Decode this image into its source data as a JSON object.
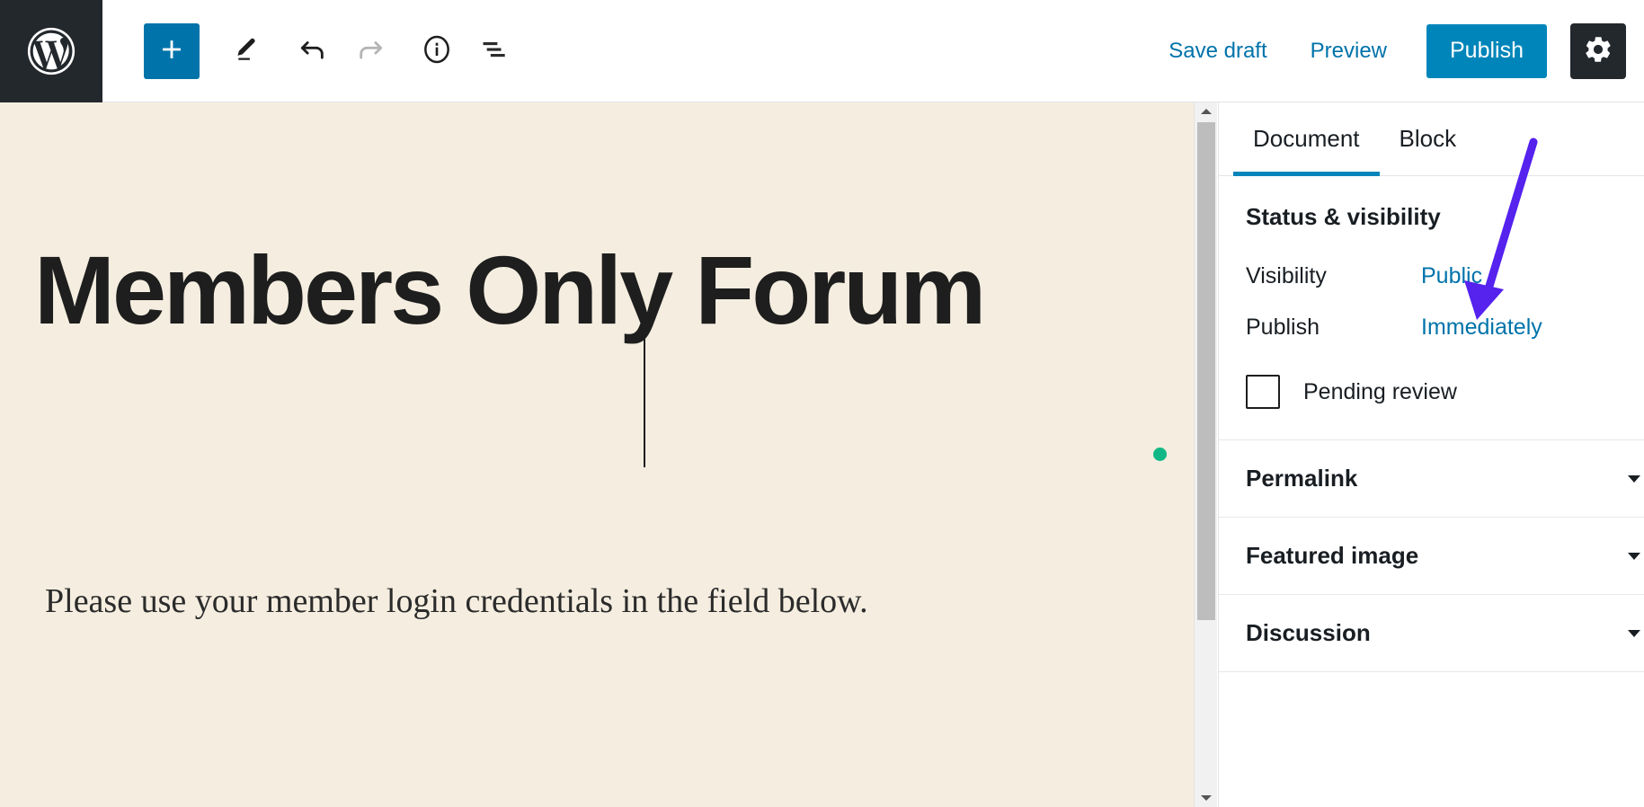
{
  "app": {
    "name": "WordPress Block Editor",
    "logo_icon": "wordpress-logo-icon"
  },
  "toolbar": {
    "left_tools": [
      {
        "name": "block-inserter-button",
        "icon": "plus-icon",
        "label": "Add block",
        "state": "primary"
      },
      {
        "name": "edit-tool-button",
        "icon": "pencil-icon",
        "label": "Edit",
        "state": "enabled"
      },
      {
        "name": "undo-button",
        "icon": "undo-arrow-icon",
        "label": "Undo",
        "state": "enabled"
      },
      {
        "name": "redo-button",
        "icon": "redo-arrow-icon",
        "label": "Redo",
        "state": "disabled"
      },
      {
        "name": "content-info-button",
        "icon": "info-circle-icon",
        "label": "Content structure",
        "state": "enabled"
      },
      {
        "name": "block-navigation-button",
        "icon": "list-view-icon",
        "label": "Block navigation",
        "state": "enabled"
      }
    ],
    "save_draft_label": "Save draft",
    "preview_label": "Preview",
    "publish_label": "Publish",
    "settings_icon": "gear-icon",
    "settings_label": "Settings"
  },
  "editor": {
    "background_color": "#f5eee0",
    "title": "Members Only Forum",
    "paragraph": "Please use your member login credentials in the field below.",
    "caret_visible": true,
    "block_indicator_color": "#11b886"
  },
  "scrollbar": {
    "up_arrow_icon": "caret-up-icon",
    "down_arrow_icon": "caret-down-icon",
    "thumb_name": "scrollbar-thumb"
  },
  "sidebar": {
    "tabs": [
      {
        "label": "Document",
        "active": true
      },
      {
        "label": "Block",
        "active": false
      }
    ],
    "status_panel": {
      "title": "Status & visibility",
      "rows": [
        {
          "label": "Visibility",
          "value": "Public"
        },
        {
          "label": "Publish",
          "value": "Immediately"
        }
      ],
      "checkbox": {
        "label": "Pending review",
        "checked": false
      }
    },
    "collapsed_panels": [
      {
        "title": "Permalink",
        "chevron_icon": "chevron-down-icon"
      },
      {
        "title": "Featured image",
        "chevron_icon": "chevron-down-icon"
      },
      {
        "title": "Discussion",
        "chevron_icon": "chevron-down-icon"
      }
    ]
  },
  "annotation": {
    "type": "arrow",
    "color": "#5522ee",
    "points_to": "Public",
    "name": "annotation-arrow-to-public"
  },
  "colors": {
    "accent_blue": "#0073aa",
    "publish_blue": "#0085ba",
    "dark_chrome": "#23282d",
    "canvas_bg": "#f5eee0",
    "annotation_purple": "#5522ee",
    "block_dot_green": "#11b886"
  }
}
